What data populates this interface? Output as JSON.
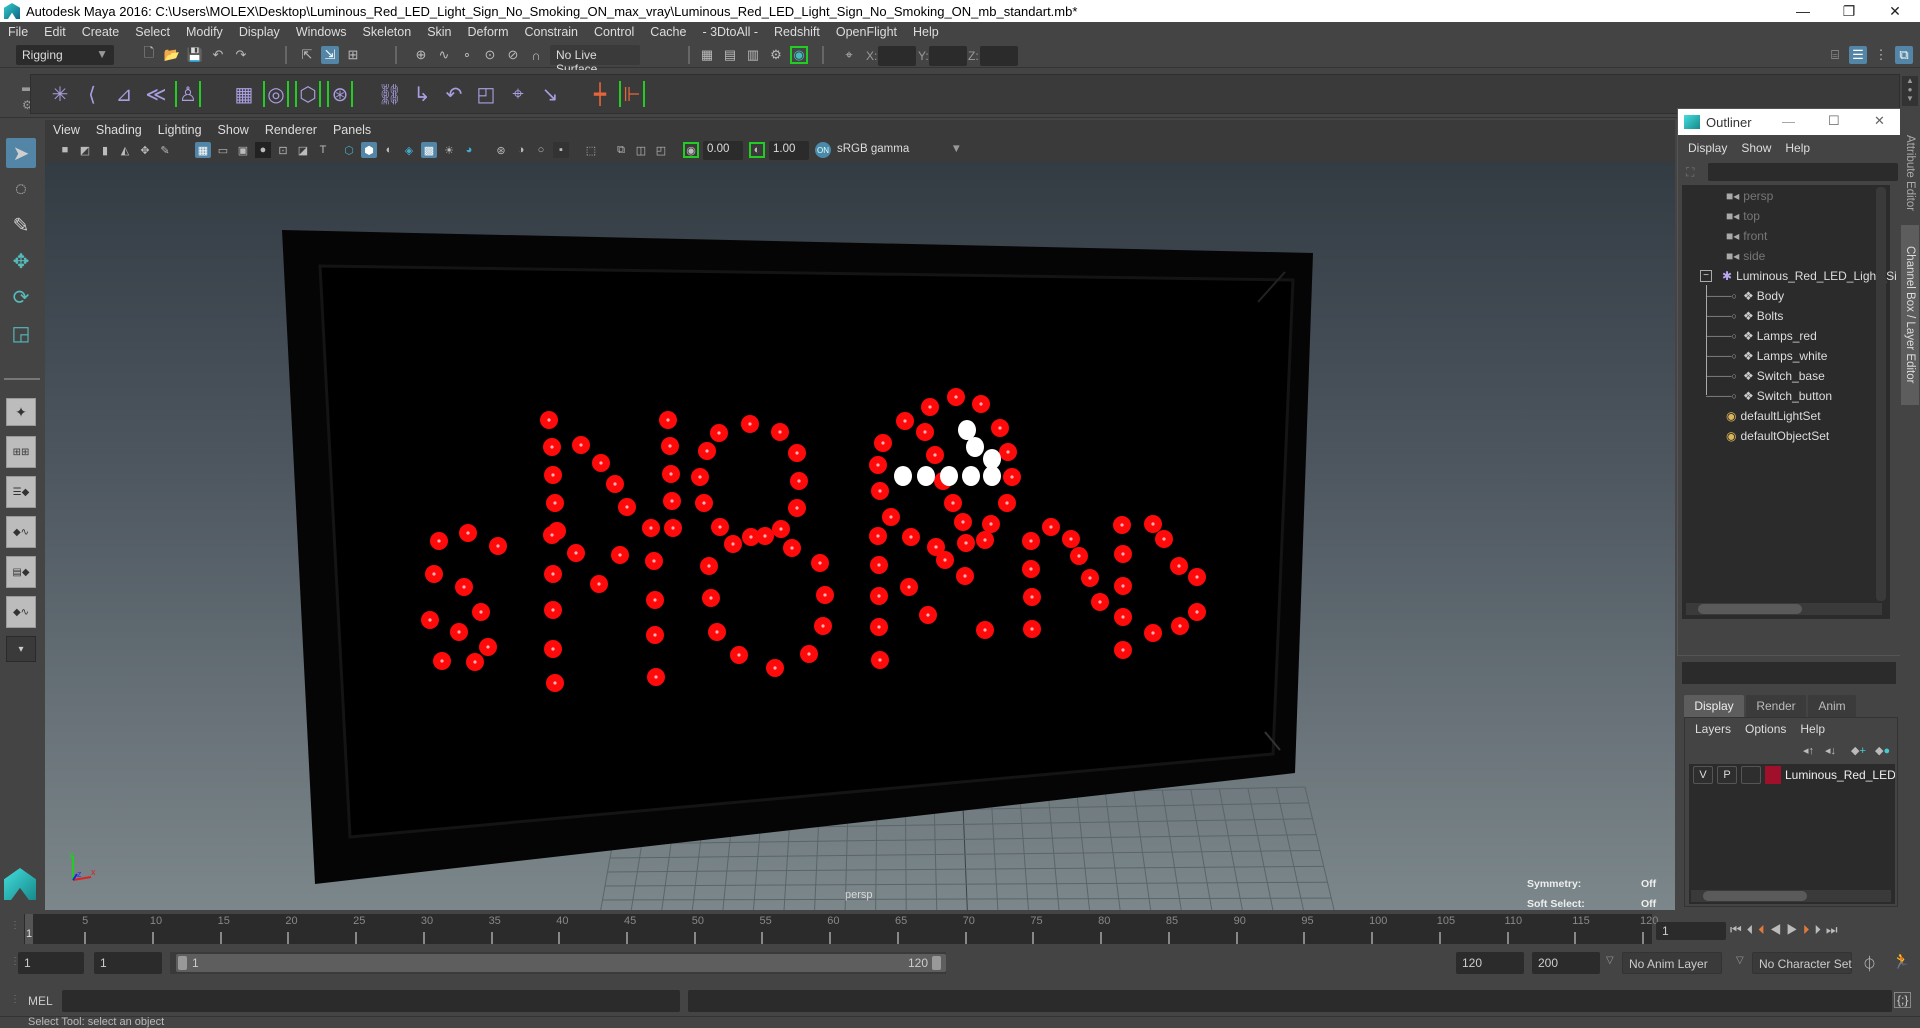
{
  "window": {
    "title": "Autodesk Maya 2016: C:\\Users\\MOLEX\\Desktop\\Luminous_Red_LED_Light_Sign_No_Smoking_ON_max_vray\\Luminous_Red_LED_Light_Sign_No_Smoking_ON_mb_standart.mb*",
    "minimize": "—",
    "maximize": "❐",
    "close": "✕"
  },
  "menubar": [
    "File",
    "Edit",
    "Create",
    "Select",
    "Modify",
    "Display",
    "Windows",
    "Skeleton",
    "Skin",
    "Deform",
    "Constrain",
    "Control",
    "Cache",
    "- 3DtoAll -",
    "Redshift",
    "OpenFlight",
    "Help"
  ],
  "statusline": {
    "menuset": "Rigging",
    "live_surface": "No Live Surface",
    "x_label": "X:",
    "y_label": "Y:",
    "z_label": "Z:",
    "x_value": "",
    "y_value": "",
    "z_value": ""
  },
  "viewport": {
    "menu": [
      "View",
      "Shading",
      "Lighting",
      "Show",
      "Renderer",
      "Panels"
    ],
    "exposure": "0.00",
    "gamma": "1.00",
    "color_space": "sRGB gamma",
    "camera_label": "persp",
    "hud": [
      {
        "label": "Symmetry:",
        "value": "Off"
      },
      {
        "label": "Soft Select:",
        "value": "Off"
      }
    ],
    "axis": {
      "x": "x",
      "y": "y",
      "z": "z"
    },
    "led_colors": {
      "red": "#ff0a0a",
      "white": "#ffffff"
    }
  },
  "outliner": {
    "title": "Outliner",
    "menu": [
      "Display",
      "Show",
      "Help"
    ],
    "filter_value": "",
    "items": [
      {
        "label": "persp",
        "type": "camera",
        "dim": true
      },
      {
        "label": "top",
        "type": "camera",
        "dim": true
      },
      {
        "label": "front",
        "type": "camera",
        "dim": true
      },
      {
        "label": "side",
        "type": "camera",
        "dim": true
      },
      {
        "label": "Luminous_Red_LED_Light_Si",
        "type": "group",
        "expanded": true
      },
      {
        "label": "Body",
        "type": "mesh",
        "child": true
      },
      {
        "label": "Bolts",
        "type": "mesh",
        "child": true
      },
      {
        "label": "Lamps_red",
        "type": "mesh",
        "child": true
      },
      {
        "label": "Lamps_white",
        "type": "mesh",
        "child": true
      },
      {
        "label": "Switch_base",
        "type": "mesh",
        "child": true
      },
      {
        "label": "Switch_button",
        "type": "mesh",
        "child": true
      },
      {
        "label": "defaultLightSet",
        "type": "set"
      },
      {
        "label": "defaultObjectSet",
        "type": "set"
      }
    ]
  },
  "side_tabs": [
    "Attribute Editor",
    "Channel Box / Layer Editor"
  ],
  "layer_editor": {
    "tabs": [
      "Display",
      "Render",
      "Anim"
    ],
    "active_tab": "Display",
    "menu": [
      "Layers",
      "Options",
      "Help"
    ],
    "layers": [
      {
        "v": "V",
        "p": "P",
        "color": "#a0102a",
        "name": "Luminous_Red_LED_Li"
      }
    ]
  },
  "timeline": {
    "ticks": [
      "5",
      "10",
      "15",
      "20",
      "25",
      "30",
      "35",
      "40",
      "45",
      "50",
      "55",
      "60",
      "65",
      "70",
      "75",
      "80",
      "85",
      "90",
      "95",
      "100",
      "105",
      "110",
      "115",
      "120"
    ],
    "current_frame_marker": "1",
    "current_frame": "1"
  },
  "range": {
    "start": "1",
    "playback_start": "1",
    "slider_start": "1",
    "slider_end": "120",
    "playback_end": "120",
    "end": "200",
    "anim_layer": "No Anim Layer",
    "character_set": "No Character Set"
  },
  "command": {
    "label": "MEL",
    "input": "",
    "result": ""
  },
  "help_line": "Select Tool: select an object"
}
